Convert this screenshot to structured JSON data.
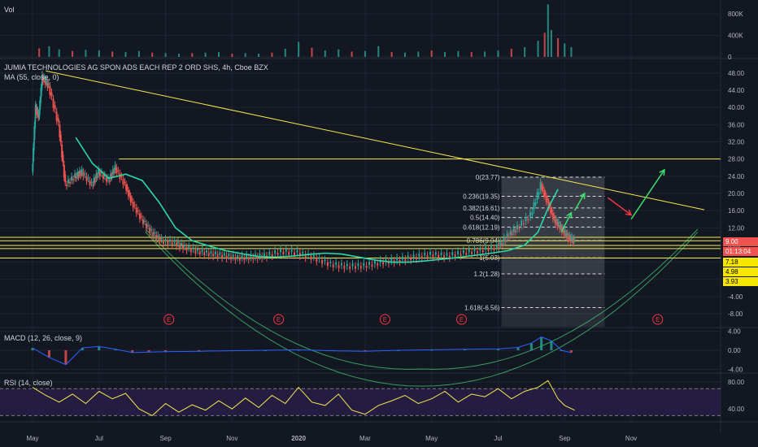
{
  "header": {
    "volume_label": "Vol",
    "symbol_title": "JUMIA TECHNOLOGIES AG SPON ADS EACH REP 2 ORD SHS, 4h, Cboe BZX",
    "ma_label": "MA (55, close, 0)",
    "macd_label": "MACD (12, 26, close, 9)",
    "rsi_label": "RSI (14, close)"
  },
  "price_tags": [
    {
      "text": "9.00",
      "bg": "#ef5350",
      "fg": "#ffffff"
    },
    {
      "text": "01:13:04",
      "bg": "#ef5350",
      "fg": "#ffffff"
    },
    {
      "text": "7.18",
      "bg": "#f7e600",
      "fg": "#000000"
    },
    {
      "text": "4.98",
      "bg": "#f7e600",
      "fg": "#000000"
    },
    {
      "text": "3.93",
      "bg": "#f7e600",
      "fg": "#000000"
    }
  ],
  "colors": {
    "background": "#131722",
    "grid": "#1f2433",
    "candle_up": "#26a69a",
    "candle_down": "#ef5350",
    "ma": "#2bd9a7",
    "trend": "#f5e94c",
    "fib": "#d9d9d9",
    "arrow_green": "#3fe06e",
    "arrow_red": "#f23645",
    "rsi_line": "#f5e94c",
    "rsi_band": "#2a1e4a",
    "earnings": "#f23645"
  },
  "chart_data": {
    "type": "line",
    "title": "JUMIA TECHNOLOGIES AG SPON ADS EACH REP 2 ORD SHS, 4h, Cboe BZX",
    "x_ticks": [
      "May",
      "Jul",
      "Sep",
      "Nov",
      "2020",
      "Mar",
      "May",
      "Jul",
      "Sep",
      "Nov"
    ],
    "x_tick_index": [
      0,
      2,
      4,
      6,
      8,
      10,
      12,
      14,
      16,
      18
    ],
    "x_range": [
      0,
      20.2
    ],
    "price_axis": {
      "ylim": [
        -11,
        51
      ],
      "ticks": [
        48,
        44,
        40,
        36,
        32,
        28,
        24,
        20,
        16,
        12,
        8,
        4,
        0,
        -4,
        -8
      ],
      "labels": [
        "48.00",
        "44.00",
        "40.00",
        "36.00",
        "32.00",
        "28.00",
        "24.00",
        "20.00",
        "16.00",
        "12.00",
        "8.00",
        "4.00",
        "0.00",
        "-4.00",
        "-8.00"
      ]
    },
    "volume_axis": {
      "ylim": [
        0,
        1000
      ],
      "ticks": [
        800,
        400,
        0
      ],
      "labels": [
        "800K",
        "400K",
        "0"
      ]
    },
    "macd_axis": {
      "ylim": [
        -4.6,
        4.6
      ],
      "ticks": [
        4,
        0,
        -4
      ],
      "labels": [
        "4.00",
        "0.00",
        "-4.00"
      ]
    },
    "rsi_axis": {
      "ylim": [
        22,
        92
      ],
      "ticks": [
        80,
        40
      ],
      "labels": [
        "80.00",
        "40.00"
      ],
      "band": [
        30,
        70
      ]
    },
    "price_series": {
      "name": "",
      "x": [
        0.0,
        0.1,
        0.2,
        0.3,
        0.5,
        0.8,
        1.0,
        1.3,
        1.5,
        1.8,
        2.0,
        2.3,
        2.5,
        2.8,
        3.0,
        3.3,
        3.6,
        3.9,
        4.3,
        4.6,
        5.0,
        5.4,
        5.8,
        6.2,
        6.6,
        7.0,
        7.5,
        8.0,
        8.5,
        9.0,
        9.5,
        10.0,
        10.5,
        11.0,
        11.5,
        12.0,
        12.5,
        13.0,
        13.5,
        14.0,
        14.3,
        14.6,
        15.0,
        15.3,
        15.5,
        15.7,
        15.9,
        16.1,
        16.3
      ],
      "y": [
        25,
        40,
        38,
        47,
        45,
        36,
        22,
        24,
        25,
        22,
        25,
        23,
        26,
        22,
        18,
        14,
        11,
        9,
        8.5,
        7.5,
        6.5,
        6,
        5.5,
        5,
        5.2,
        5.5,
        6.5,
        6.2,
        5,
        3.5,
        3.0,
        3.2,
        4.0,
        4.5,
        5.2,
        5.8,
        5.5,
        6.2,
        6.8,
        7.5,
        10,
        12,
        15,
        22,
        18,
        14,
        12,
        10,
        9
      ]
    },
    "ma": {
      "name": "MA (55, close, 0)",
      "x": [
        1.3,
        1.8,
        2.3,
        2.8,
        3.3,
        3.8,
        4.3,
        4.8,
        5.3,
        5.8,
        6.3,
        6.8,
        7.3,
        7.8,
        8.3,
        8.8,
        9.3,
        9.8,
        10.3,
        10.8,
        11.3,
        11.8,
        12.3,
        12.8,
        13.3,
        13.8,
        14.3,
        14.8,
        15.2,
        15.5,
        15.8
      ],
      "y": [
        33,
        27,
        23.5,
        24.5,
        23,
        18,
        12,
        9,
        7.8,
        6.7,
        6,
        5.3,
        5.2,
        5.4,
        5.8,
        6.1,
        5.9,
        5.2,
        4.5,
        4.0,
        4.0,
        4.3,
        4.7,
        5.1,
        5.6,
        6.1,
        6.7,
        8.0,
        11,
        16.5,
        21
      ]
    },
    "horizontal_levels": [
      28.0,
      9.8,
      9.0,
      7.9,
      7.18,
      4.98
    ],
    "trend_line": {
      "x": [
        0.4,
        20.2
      ],
      "y": [
        48.5,
        16.2
      ]
    },
    "fibonacci": {
      "x_range": [
        14.1,
        17.2
      ],
      "levels": [
        {
          "ratio": "0",
          "value": 23.77,
          "label": "0(23.77)"
        },
        {
          "ratio": "0.236",
          "value": 19.35,
          "label": "0.236(19.35)"
        },
        {
          "ratio": "0.382",
          "value": 16.61,
          "label": "0.382(16.61)"
        },
        {
          "ratio": "0.5",
          "value": 14.4,
          "label": "0.5(14.40)"
        },
        {
          "ratio": "0.618",
          "value": 12.19,
          "label": "0.618(12.19)"
        },
        {
          "ratio": "0.786",
          "value": 9.04,
          "label": "0.786(9.04)"
        },
        {
          "ratio": "1",
          "value": 5.03,
          "label": "1(5.03)"
        },
        {
          "ratio": "1.2",
          "value": 1.28,
          "label": "1.2(1.28)"
        },
        {
          "ratio": "1.618",
          "value": -6.56,
          "label": "1.618(-6.56)"
        }
      ]
    },
    "earnings_markers": {
      "x": [
        4.1,
        7.4,
        10.6,
        12.9,
        18.8
      ],
      "label": "E"
    },
    "volume": {
      "x": [
        0.2,
        0.5,
        0.8,
        1.2,
        1.6,
        2.0,
        2.4,
        2.8,
        3.2,
        3.6,
        4.0,
        4.4,
        4.8,
        5.2,
        5.6,
        6.0,
        6.4,
        6.8,
        7.2,
        7.6,
        8.0,
        8.4,
        8.8,
        9.2,
        9.6,
        10.0,
        10.4,
        10.8,
        11.2,
        11.6,
        12.0,
        12.4,
        12.8,
        13.2,
        13.6,
        14.0,
        14.4,
        14.8,
        15.2,
        15.4,
        15.5,
        15.6,
        15.8,
        16.0,
        16.2
      ],
      "values": [
        160,
        200,
        140,
        110,
        130,
        120,
        100,
        90,
        110,
        80,
        70,
        60,
        70,
        80,
        90,
        60,
        70,
        60,
        80,
        150,
        280,
        170,
        120,
        140,
        100,
        110,
        200,
        90,
        80,
        100,
        120,
        90,
        110,
        90,
        100,
        120,
        150,
        180,
        300,
        450,
        980,
        500,
        350,
        250,
        180
      ]
    },
    "macd": {
      "x": [
        0.0,
        0.5,
        1.0,
        1.5,
        2.0,
        2.5,
        3.0,
        3.5,
        4.0,
        5.0,
        6.0,
        7.0,
        8.0,
        9.0,
        10.0,
        11.0,
        12.0,
        13.0,
        14.0,
        14.6,
        15.0,
        15.3,
        15.6,
        15.9,
        16.2
      ],
      "values": [
        0.5,
        -1.5,
        -3.0,
        0.5,
        0.8,
        0.2,
        -0.5,
        -0.4,
        -0.3,
        -0.2,
        -0.1,
        0.0,
        0.1,
        -0.1,
        -0.2,
        0.0,
        0.1,
        0.2,
        0.3,
        0.6,
        1.5,
        2.8,
        2.0,
        0.0,
        -0.5
      ]
    },
    "rsi": {
      "x": [
        0.0,
        0.4,
        0.8,
        1.2,
        1.6,
        2.0,
        2.4,
        2.8,
        3.2,
        3.6,
        4.0,
        4.4,
        4.8,
        5.2,
        5.6,
        6.0,
        6.4,
        6.8,
        7.2,
        7.6,
        8.0,
        8.4,
        8.8,
        9.2,
        9.6,
        10.0,
        10.4,
        10.8,
        11.2,
        11.6,
        12.0,
        12.4,
        12.8,
        13.2,
        13.6,
        14.0,
        14.4,
        14.8,
        15.2,
        15.5,
        15.8,
        16.0,
        16.3
      ],
      "values": [
        72,
        60,
        50,
        62,
        48,
        66,
        55,
        63,
        40,
        30,
        48,
        35,
        46,
        38,
        52,
        40,
        56,
        42,
        60,
        48,
        72,
        50,
        45,
        62,
        38,
        32,
        45,
        52,
        60,
        48,
        55,
        66,
        50,
        62,
        58,
        70,
        55,
        66,
        72,
        82,
        55,
        45,
        38
      ]
    }
  }
}
